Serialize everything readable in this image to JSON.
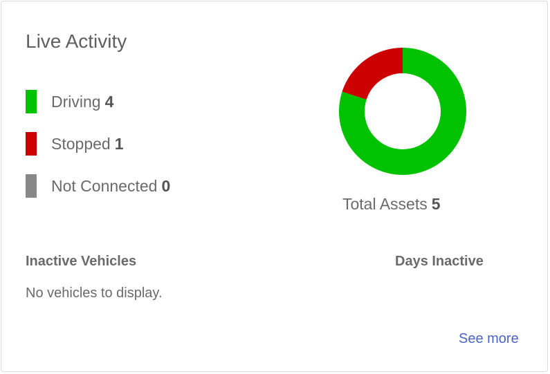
{
  "card": {
    "title": "Live Activity"
  },
  "legend": [
    {
      "label": "Driving",
      "count": "4",
      "color": "#00c200"
    },
    {
      "label": "Stopped",
      "count": "1",
      "color": "#cc0000"
    },
    {
      "label": "Not Connected",
      "count": "0",
      "color": "#888888"
    }
  ],
  "donut": {
    "segments": [
      {
        "label": "Driving",
        "value": 4,
        "color": "#00c200"
      },
      {
        "label": "Stopped",
        "value": 1,
        "color": "#cc0000"
      },
      {
        "label": "Not Connected",
        "value": 0,
        "color": "#888888"
      }
    ]
  },
  "total": {
    "label": "Total Assets",
    "count": "5"
  },
  "inactive": {
    "vehicles_header": "Inactive Vehicles",
    "days_header": "Days Inactive",
    "empty_message": "No vehicles to display."
  },
  "footer": {
    "see_more_label": "See more",
    "link_color": "#4a63c8"
  }
}
